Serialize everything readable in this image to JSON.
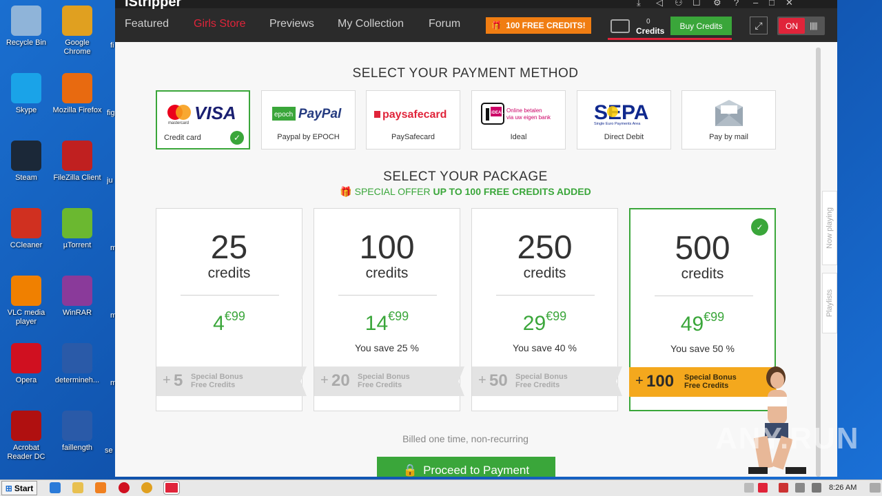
{
  "desktop": {
    "icons": [
      {
        "label": "Recycle Bin",
        "color": "#8fb4d9"
      },
      {
        "label": "Google Chrome",
        "color": "#e0a020"
      },
      {
        "label": "Skype",
        "color": "#1aa3e8"
      },
      {
        "label": "Mozilla Firefox",
        "color": "#e86a10"
      },
      {
        "label": "Steam",
        "color": "#1b2838"
      },
      {
        "label": "FileZilla Client",
        "color": "#c02020"
      },
      {
        "label": "CCleaner",
        "color": "#d03020"
      },
      {
        "label": "µTorrent",
        "color": "#6bb830"
      },
      {
        "label": "VLC media player",
        "color": "#f08000"
      },
      {
        "label": "WinRAR",
        "color": "#8a3a9a"
      },
      {
        "label": "Opera",
        "color": "#d01020"
      },
      {
        "label": "determineh...",
        "color": "#2a5aa8"
      },
      {
        "label": "Acrobat Reader DC",
        "color": "#b01010"
      },
      {
        "label": "faillength",
        "color": "#2a5aa8"
      }
    ],
    "partial_labels": [
      "fi",
      "fig",
      "ju",
      "m",
      "m",
      "m",
      "se"
    ]
  },
  "app": {
    "brand": "iStripper",
    "nav": [
      "Featured",
      "Girls Store",
      "Previews",
      "My Collection",
      "Forum"
    ],
    "active_nav": "Girls Store",
    "free_credits_button": "100 FREE CREDITS!",
    "credits_count": "0",
    "credits_label": "Credits",
    "buy_button": "Buy Credits",
    "toggle_label": "ON",
    "side_tabs": [
      "Now playing",
      "Playlists"
    ]
  },
  "payment": {
    "title": "SELECT YOUR PAYMENT METHOD",
    "methods": [
      {
        "name": "Credit card",
        "logo": "VISA",
        "selected": true
      },
      {
        "name": "Paypal by EPOCH",
        "logo": "PayPal",
        "selected": false
      },
      {
        "name": "PaySafecard",
        "logo": "paysafecard",
        "selected": false
      },
      {
        "name": "Ideal",
        "logo": "iDEAL",
        "selected": false
      },
      {
        "name": "Direct Debit",
        "logo": "SEPA",
        "selected": false
      },
      {
        "name": "Pay by mail",
        "logo": "mail",
        "selected": false
      }
    ],
    "logo_subtexts": {
      "mastercard": "mastercard",
      "epoch": "epoch",
      "ideal_line1": "Online betalen",
      "ideal_line2": "via uw eigen bank",
      "sepa_sub": "Single Euro Payments Area"
    }
  },
  "package": {
    "title": "SELECT YOUR PACKAGE",
    "offer_prefix": "SPECIAL OFFER",
    "offer_bold": "UP TO 100 FREE CREDITS ADDED",
    "unit_label": "credits",
    "bonus_line1": "Special Bonus",
    "bonus_line2": "Free Credits",
    "items": [
      {
        "amount": "25",
        "price_main": "4",
        "price_cents": "€99",
        "save": "",
        "bonus": "5",
        "selected": false
      },
      {
        "amount": "100",
        "price_main": "14",
        "price_cents": "€99",
        "save": "You save 25 %",
        "bonus": "20",
        "selected": false
      },
      {
        "amount": "250",
        "price_main": "29",
        "price_cents": "€99",
        "save": "You save 40 %",
        "bonus": "50",
        "selected": false
      },
      {
        "amount": "500",
        "price_main": "49",
        "price_cents": "€99",
        "save": "You save 50 %",
        "bonus": "100",
        "selected": true
      }
    ]
  },
  "billed_text": "Billed one time, non-recurring",
  "proceed_button": "Proceed to Payment",
  "taskbar": {
    "start": "Start",
    "clock": "8:26 AM"
  },
  "watermark": "ANY.RUN",
  "colors": {
    "accent_green": "#3aa63a",
    "accent_red": "#e0243a",
    "accent_orange": "#f07d12",
    "bonus_gold": "#f4a81d"
  }
}
